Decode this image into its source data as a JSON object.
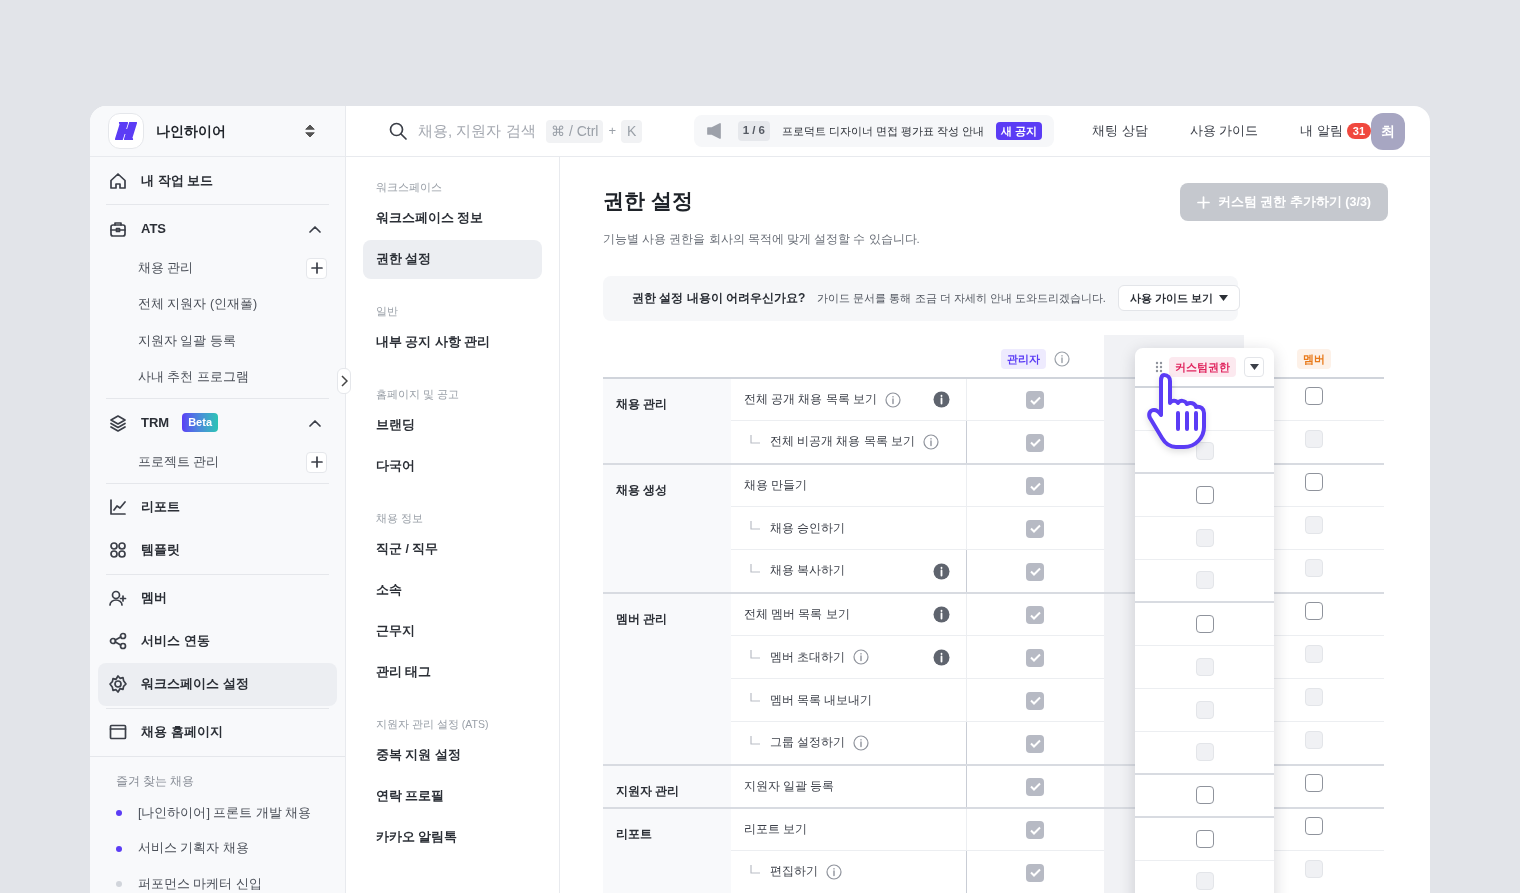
{
  "workspace": {
    "name": "나인하이어"
  },
  "search": {
    "placeholder": "채용, 지원자 검색",
    "keys": [
      "⌘ / Ctrl",
      "K"
    ],
    "joiner": "+"
  },
  "notice": {
    "counter": "1 / 6",
    "text": "프로덕트 디자이너 면접 평가표 작성 안내",
    "badge": "새 공지"
  },
  "top_links": [
    "채팅 상담",
    "사용 가이드"
  ],
  "alerts": {
    "label": "내 알림",
    "count": "31"
  },
  "avatar": "최",
  "sidebar": {
    "sections": [
      [
        {
          "label": "내 작업 보드",
          "selected": false
        }
      ],
      [
        {
          "label": "ATS",
          "selected": false,
          "expanded": true,
          "children": [
            {
              "label": "채용 관리",
              "add": true
            },
            {
              "label": "전체 지원자 (인재풀)",
              "add": false
            },
            {
              "label": "지원자 일괄 등록",
              "add": false
            },
            {
              "label": "사내 추천 프로그램",
              "add": false
            }
          ]
        }
      ],
      [
        {
          "label": "TRM",
          "badge": "Beta",
          "selected": false,
          "expanded": true,
          "children": [
            {
              "label": "프로젝트 관리",
              "add": true
            }
          ]
        }
      ],
      [
        {
          "label": "리포트",
          "selected": false
        },
        {
          "label": "템플릿",
          "selected": false
        }
      ],
      [
        {
          "label": "멤버",
          "selected": false
        },
        {
          "label": "서비스 연동",
          "selected": false
        },
        {
          "label": "워크스페이스 설정",
          "selected": true
        }
      ],
      [
        {
          "label": "채용 홈페이지",
          "selected": false
        }
      ]
    ],
    "favorites": {
      "title": "즐겨 찾는 채용",
      "items": [
        {
          "label": "[나인하이어] 프론트 개발 채용",
          "color": "#5b3cf5"
        },
        {
          "label": "서비스 기획자 채용",
          "color": "#5b3cf5"
        },
        {
          "label": "퍼포먼스 마케터 신입",
          "color": "#d1d5db"
        }
      ]
    }
  },
  "settings_nav": [
    {
      "title": "워크스페이스",
      "items": [
        {
          "label": "워크스페이스 정보",
          "selected": false
        },
        {
          "label": "권한 설정",
          "selected": true
        }
      ]
    },
    {
      "title": "일반",
      "items": [
        {
          "label": "내부 공지 사항 관리",
          "selected": false
        }
      ]
    },
    {
      "title": "홈페이지 및 공고",
      "items": [
        {
          "label": "브랜딩",
          "selected": false
        },
        {
          "label": "다국어",
          "selected": false
        }
      ]
    },
    {
      "title": "채용 정보",
      "items": [
        {
          "label": "직군 / 직무",
          "selected": false
        },
        {
          "label": "소속",
          "selected": false
        },
        {
          "label": "근무지",
          "selected": false
        },
        {
          "label": "관리 태그",
          "selected": false
        }
      ]
    },
    {
      "title": "지원자 관리 설정 (ATS)",
      "items": [
        {
          "label": "중복 지원 설정",
          "selected": false
        },
        {
          "label": "연락 프로필",
          "selected": false
        },
        {
          "label": "카카오 알림톡",
          "selected": false
        }
      ]
    }
  ],
  "page": {
    "title": "권한 설정",
    "subtitle": "기능별 사용 권한을 회사의 목적에 맞게 설정할 수 있습니다.",
    "add_button": {
      "label": "커스텀 권한 추가하기 (3/3)",
      "disabled": true
    },
    "help": {
      "title": "권한 설정 내용이 어려우신가요?",
      "text": "가이드 문서를 통해 조금 더 자세히 안내 도와드리겠습니다.",
      "button": "사용 가이드 보기"
    }
  },
  "table": {
    "columns": [
      {
        "label": "관리자",
        "color": "#5b3cf5",
        "info": true,
        "dragging": false
      },
      {
        "label": "커스텀권한",
        "color": "#e0245e",
        "info": false,
        "dragging": true
      },
      {
        "label": "멤버",
        "color": "#e87a1b",
        "info": false,
        "dragging": false
      }
    ],
    "groups": [
      {
        "name": "채용 관리",
        "rows": [
          {
            "label": "전체 공개 채용 목록 보기",
            "sub": false,
            "hint": true,
            "note": true,
            "cells": [
              {
                "checked": true,
                "disabled": true
              },
              null,
              {
                "checked": false,
                "disabled": false
              }
            ]
          },
          {
            "label": "전체 비공개 채용 목록 보기",
            "sub": true,
            "hint": true,
            "note": false,
            "cells": [
              {
                "checked": true,
                "disabled": true
              },
              {
                "checked": false,
                "disabled": true
              },
              {
                "checked": false,
                "disabled": true
              }
            ]
          }
        ]
      },
      {
        "name": "채용 생성",
        "rows": [
          {
            "label": "채용 만들기",
            "sub": false,
            "hint": false,
            "note": false,
            "cells": [
              {
                "checked": true,
                "disabled": true
              },
              {
                "checked": false,
                "disabled": false
              },
              {
                "checked": false,
                "disabled": false
              }
            ]
          },
          {
            "label": "채용 승인하기",
            "sub": true,
            "hint": false,
            "note": false,
            "cells": [
              {
                "checked": true,
                "disabled": true
              },
              {
                "checked": false,
                "disabled": true
              },
              {
                "checked": false,
                "disabled": true
              }
            ]
          },
          {
            "label": "채용 복사하기",
            "sub": true,
            "hint": false,
            "note": true,
            "cells": [
              {
                "checked": true,
                "disabled": true
              },
              {
                "checked": false,
                "disabled": true
              },
              {
                "checked": false,
                "disabled": true
              }
            ]
          }
        ]
      },
      {
        "name": "멤버 관리",
        "rows": [
          {
            "label": "전체 멤버 목록 보기",
            "sub": false,
            "hint": false,
            "note": true,
            "cells": [
              {
                "checked": true,
                "disabled": true
              },
              {
                "checked": false,
                "disabled": false
              },
              {
                "checked": false,
                "disabled": false
              }
            ]
          },
          {
            "label": "멤버 초대하기",
            "sub": true,
            "hint": true,
            "note": true,
            "cells": [
              {
                "checked": true,
                "disabled": true
              },
              {
                "checked": false,
                "disabled": true
              },
              {
                "checked": false,
                "disabled": true
              }
            ]
          },
          {
            "label": "멤버 목록 내보내기",
            "sub": true,
            "hint": false,
            "note": false,
            "cells": [
              {
                "checked": true,
                "disabled": true
              },
              {
                "checked": false,
                "disabled": true
              },
              {
                "checked": false,
                "disabled": true
              }
            ]
          },
          {
            "label": "그룹 설정하기",
            "sub": true,
            "hint": true,
            "note": false,
            "cells": [
              {
                "checked": true,
                "disabled": true
              },
              {
                "checked": false,
                "disabled": true
              },
              {
                "checked": false,
                "disabled": true
              }
            ]
          }
        ]
      },
      {
        "name": "지원자 관리",
        "rows": [
          {
            "label": "지원자 일괄 등록",
            "sub": false,
            "hint": false,
            "note": false,
            "cells": [
              {
                "checked": true,
                "disabled": true
              },
              {
                "checked": false,
                "disabled": false
              },
              {
                "checked": false,
                "disabled": false
              }
            ]
          }
        ]
      },
      {
        "name": "리포트",
        "rows": [
          {
            "label": "리포트 보기",
            "sub": false,
            "hint": false,
            "note": false,
            "cells": [
              {
                "checked": true,
                "disabled": true
              },
              {
                "checked": false,
                "disabled": false
              },
              {
                "checked": false,
                "disabled": false
              }
            ]
          },
          {
            "label": "편집하기",
            "sub": true,
            "hint": true,
            "note": false,
            "cells": [
              {
                "checked": true,
                "disabled": true
              },
              {
                "checked": false,
                "disabled": true
              },
              {
                "checked": false,
                "disabled": true
              }
            ]
          }
        ]
      }
    ]
  }
}
